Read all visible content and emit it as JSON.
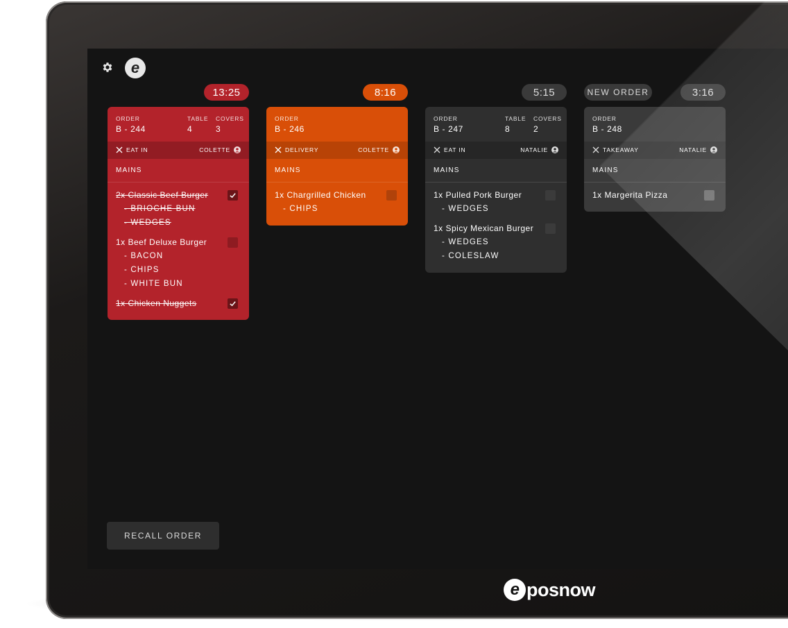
{
  "timers": [
    "13:25",
    "8:16",
    "5:15",
    "3:16"
  ],
  "new_order_label": "NEW ORDER",
  "labels": {
    "order": "ORDER",
    "table": "TABLE",
    "covers": "COVERS"
  },
  "orders": [
    {
      "order": "B - 244",
      "table": "4",
      "covers": "3",
      "type": "EAT IN",
      "server": "COLETTE",
      "section": "MAINS",
      "color": "#b3232b",
      "items": [
        {
          "name": "2x Classic Beef Burger",
          "mods": [
            "- BRIOCHE BUN",
            "- WEDGES"
          ],
          "done": true
        },
        {
          "name": "1x Beef Deluxe Burger",
          "mods": [
            "- BACON",
            "- CHIPS",
            "- WHITE BUN"
          ],
          "done": false
        },
        {
          "name": "1x Chicken Nuggets",
          "mods": [],
          "done": true
        }
      ]
    },
    {
      "order": "B - 246",
      "type": "DELIVERY",
      "server": "COLETTE",
      "section": "MAINS",
      "color": "#d94f08",
      "items": [
        {
          "name": "1x Chargrilled Chicken",
          "mods": [
            "- CHIPS"
          ],
          "done": false
        }
      ]
    },
    {
      "order": "B - 247",
      "table": "8",
      "covers": "2",
      "type": "EAT IN",
      "server": "NATALIE",
      "section": "MAINS",
      "color": "#2f2f2f",
      "items": [
        {
          "name": "1x Pulled Pork Burger",
          "mods": [
            "- WEDGES"
          ],
          "done": false
        },
        {
          "name": "1x Spicy Mexican Burger",
          "mods": [
            "- WEDGES",
            "- COLESLAW"
          ],
          "done": false
        }
      ]
    },
    {
      "order": "B - 248",
      "type": "TAKEAWAY",
      "server": "NATALIE",
      "section": "MAINS",
      "color": "#3a3a3a",
      "items": [
        {
          "name": "1x Margerita Pizza",
          "mods": [],
          "done": false
        }
      ]
    }
  ],
  "recall_label": "RECALL ORDER",
  "brand": "posnow",
  "brand_e": "e",
  "logo_badge_letter": "e",
  "icons": {
    "settings": "gear-icon",
    "logo": "eposnow-logo-icon",
    "type": "cutlery-icon",
    "server": "user-icon",
    "check": "check-icon"
  },
  "colors": {
    "timer_red": "#b3232b",
    "timer_orange": "#d94f08",
    "timer_grey": "#3a3a3a"
  }
}
